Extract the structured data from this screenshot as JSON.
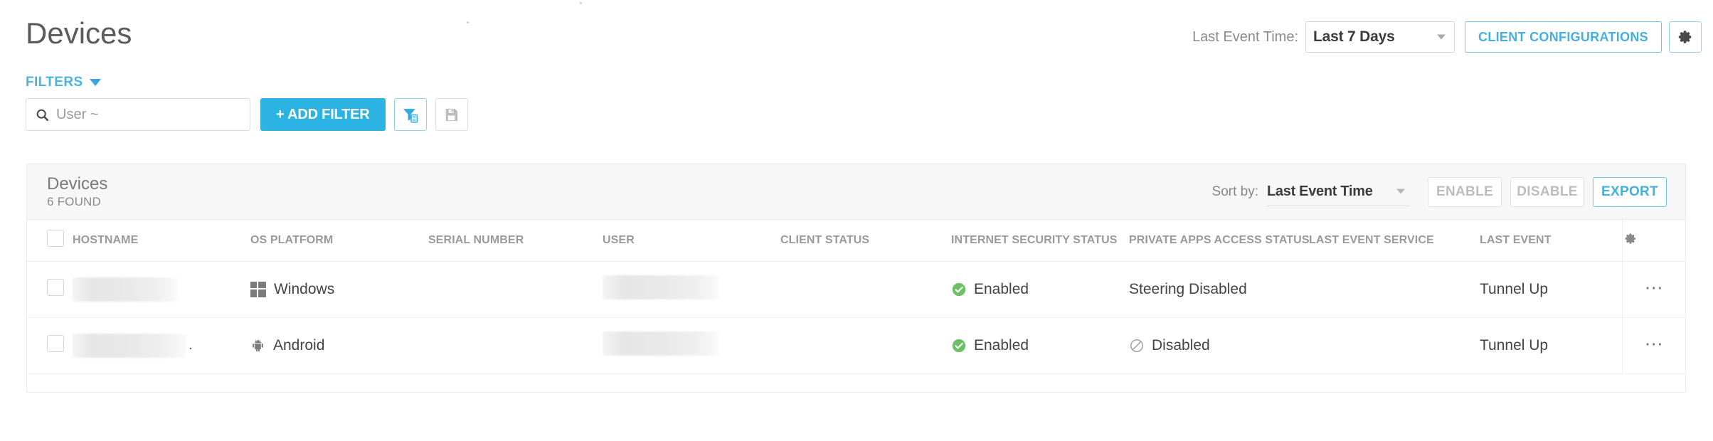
{
  "header": {
    "title": "Devices",
    "last_event_time_label": "Last Event Time:",
    "last_event_time_value": "Last 7 Days",
    "client_configurations_label": "CLIENT CONFIGURATIONS",
    "settings_icon": "gear-icon"
  },
  "filters": {
    "label": "FILTERS",
    "search_placeholder": "User ~",
    "search_value": "",
    "add_filter_label": "+ ADD FILTER",
    "saved_filter_icon": "filter-save-icon",
    "save_icon": "floppy-save-icon"
  },
  "card": {
    "title": "Devices",
    "count_label": "6 FOUND",
    "sort_by_label": "Sort by:",
    "sort_by_value": "Last Event Time",
    "enable_label": "ENABLE",
    "disable_label": "DISABLE",
    "export_label": "EXPORT"
  },
  "table": {
    "columns": [
      "HOSTNAME",
      "OS PLATFORM",
      "SERIAL NUMBER",
      "USER",
      "CLIENT STATUS",
      "INTERNET SECURITY STATUS",
      "PRIVATE APPS ACCESS STATUS",
      "LAST EVENT SERVICE",
      "LAST EVENT"
    ],
    "settings_icon": "gear-icon",
    "rows": [
      {
        "hostname": "",
        "hostname_redacted": true,
        "os_platform": "Windows",
        "os_icon": "windows-icon",
        "serial_number": "",
        "user": "",
        "user_redacted": true,
        "client_status": "",
        "internet_security_status": "Enabled",
        "internet_security_icon": "check-circle-icon",
        "private_apps_access_status": "Steering Disabled",
        "private_apps_access_icon": "",
        "last_event_service": "",
        "last_event": "Tunnel Up",
        "row_menu_icon": "ellipsis-icon"
      },
      {
        "hostname": "",
        "hostname_redacted": true,
        "hostname_suffix": ".",
        "os_platform": "Android",
        "os_icon": "android-icon",
        "serial_number": "",
        "user": "",
        "user_redacted": true,
        "client_status": "",
        "internet_security_status": "Enabled",
        "internet_security_icon": "check-circle-icon",
        "private_apps_access_status": "Disabled",
        "private_apps_access_icon": "blocked-circle-icon",
        "last_event_service": "",
        "last_event": "Tunnel Up",
        "row_menu_icon": "ellipsis-icon"
      }
    ]
  },
  "colors": {
    "accent": "#2bb4e3",
    "accent_link": "#45b0e0",
    "success": "#66c05a",
    "muted": "#bdbdbd",
    "header_band": "#f7f7f7"
  }
}
